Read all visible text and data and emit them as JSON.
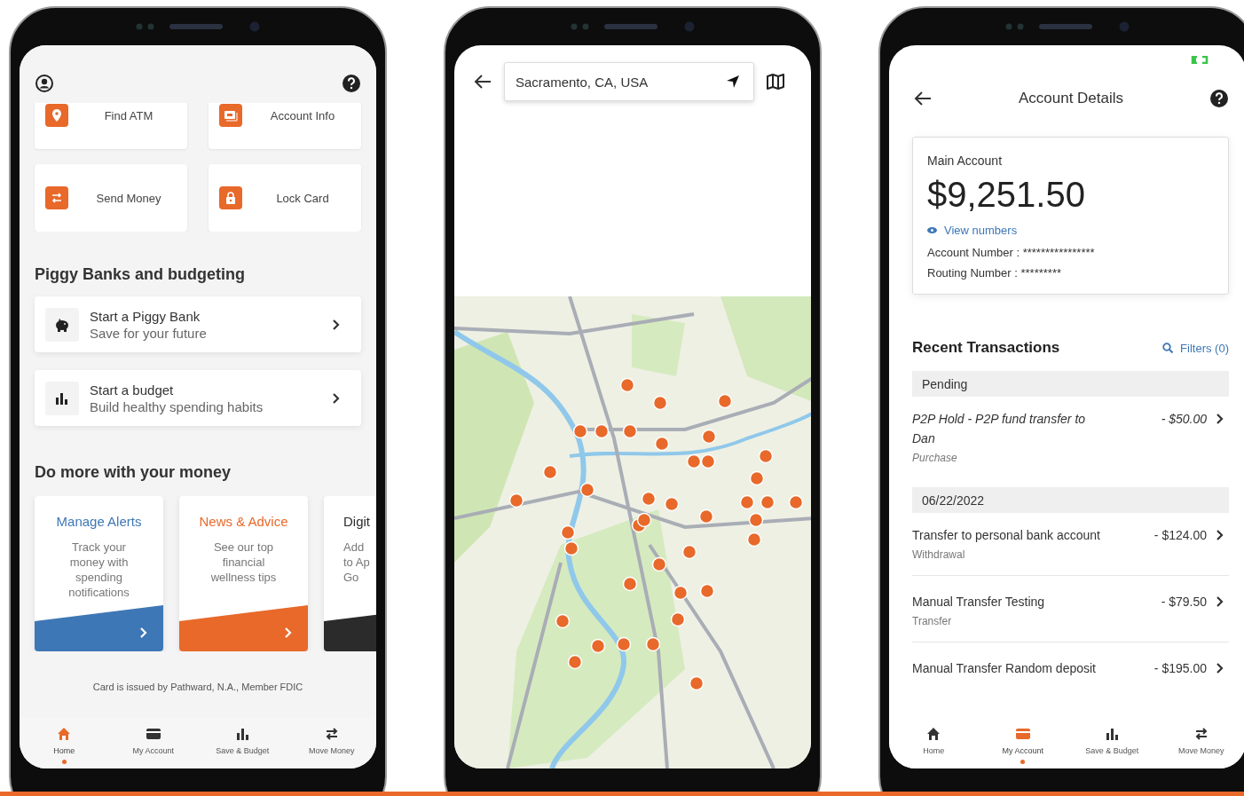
{
  "home_screen": {
    "quick_actions": [
      {
        "label": "Find ATM"
      },
      {
        "label": "Account Info"
      },
      {
        "label": "Send Money"
      },
      {
        "label": "Lock Card"
      }
    ],
    "piggy_section": {
      "title": "Piggy Banks and budgeting",
      "items": [
        {
          "title": "Start a Piggy Bank",
          "subtitle": "Save for your future"
        },
        {
          "title": "Start a budget",
          "subtitle": "Build healthy spending habits"
        }
      ]
    },
    "more_section": {
      "title": "Do more with your money",
      "cards": [
        {
          "title": "Manage Alerts",
          "lines": [
            "Track your",
            "money with",
            "spending",
            "notifications"
          ],
          "color": "#3e77b6"
        },
        {
          "title": "News & Advice",
          "lines": [
            "See our top",
            "financial",
            "wellness tips"
          ],
          "color": "#e8692a"
        },
        {
          "title": "Digit",
          "lines": [
            "Add",
            "to Ap",
            "Go"
          ],
          "color": "#2b2b2b"
        }
      ]
    },
    "disclaimer": "Card is issued by Pathward, N.A., Member FDIC",
    "nav": [
      {
        "label": "Home",
        "selected": true
      },
      {
        "label": "My Account",
        "selected": false
      },
      {
        "label": "Save & Budget",
        "selected": false
      },
      {
        "label": "Move Money",
        "selected": false
      }
    ]
  },
  "map_screen": {
    "search": {
      "value": "Sacramento, CA, USA"
    }
  },
  "account_screen": {
    "title": "Account Details",
    "account": {
      "name": "Main Account",
      "balance": "$9,251.50",
      "view_link": "View numbers",
      "account_number": "Account Number : ****************",
      "routing_number": "Routing Number : *********"
    },
    "transactions": {
      "title": "Recent Transactions",
      "filters": "Filters (0)",
      "groups": [
        {
          "header": "Pending",
          "items": [
            {
              "title": "P2P Hold - P2P fund transfer to Dan",
              "amount": "- $50.00",
              "type": "Purchase",
              "pending": true
            }
          ]
        },
        {
          "header": "06/22/2022",
          "items": [
            {
              "title": "Transfer to personal bank account",
              "amount": "- $124.00",
              "type": "Withdrawal",
              "pending": false
            },
            {
              "title": "Manual Transfer Testing",
              "amount": "- $79.50",
              "type": "Transfer",
              "pending": false
            },
            {
              "title": "Manual Transfer Random deposit",
              "amount": "- $195.00",
              "pending": false
            }
          ]
        }
      ]
    },
    "nav": [
      {
        "label": "Home",
        "selected": false
      },
      {
        "label": "My Account",
        "selected": true
      },
      {
        "label": "Save & Budget",
        "selected": false
      },
      {
        "label": "Move Money",
        "selected": false
      }
    ]
  }
}
